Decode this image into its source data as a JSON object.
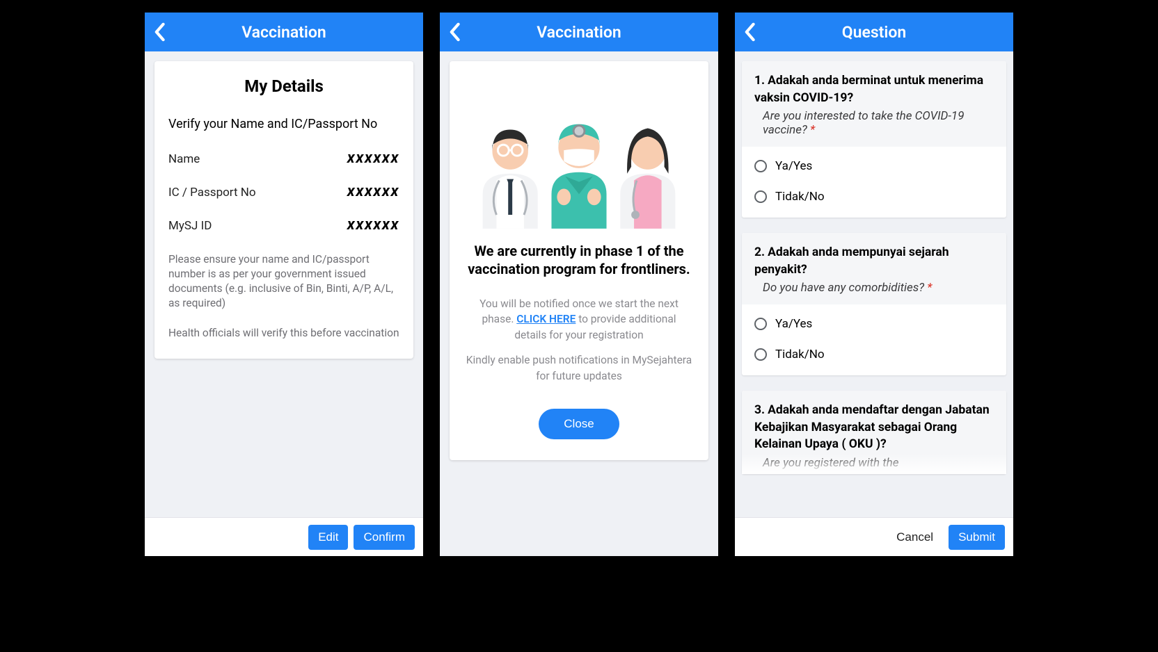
{
  "screens": [
    {
      "header": {
        "title": "Vaccination"
      },
      "card": {
        "title": "My Details",
        "verify": "Verify your Name and IC/Passport No",
        "rows": [
          {
            "label": "Name",
            "value": "XXXXXX"
          },
          {
            "label": "IC / Passport No",
            "value": "XXXXXX"
          },
          {
            "label": "MySJ ID",
            "value": "XXXXXX"
          }
        ],
        "note1": "Please ensure your name and IC/passport number is as per your government issued documents (e.g. inclusive of Bin, Binti, A/P, A/L, as required)",
        "note2": "Health officials will verify this before vaccination"
      },
      "footer": {
        "edit": "Edit",
        "confirm": "Confirm"
      }
    },
    {
      "header": {
        "title": "Vaccination"
      },
      "phase_title": "We are currently in phase 1 of the vaccination program for frontliners.",
      "info1_pre": "You will be notified once we start the next phase. ",
      "info1_link": "CLICK HERE",
      "info1_post": " to provide additional details for your registration",
      "info2": "Kindly enable push notifications in MySejahtera for future updates",
      "close": "Close"
    },
    {
      "header": {
        "title": "Question"
      },
      "questions": [
        {
          "num": "1.",
          "text": "Adakah anda berminat untuk menerima vaksin COVID-19?",
          "trans": "Are you interested to take the COVID-19 vaccine?",
          "required": "*",
          "options": [
            "Ya/Yes",
            "Tidak/No"
          ]
        },
        {
          "num": "2.",
          "text": "Adakah anda mempunyai sejarah penyakit?",
          "trans": "Do you have any comorbidities?",
          "required": "*",
          "options": [
            "Ya/Yes",
            "Tidak/No"
          ]
        },
        {
          "num": "3.",
          "text": "Adakah anda mendaftar dengan Jabatan Kebajikan Masyarakat sebagai Orang Kelainan Upaya ( OKU )?",
          "trans": "Are you registered with the",
          "required": "",
          "options": []
        }
      ],
      "footer": {
        "cancel": "Cancel",
        "submit": "Submit"
      }
    }
  ]
}
